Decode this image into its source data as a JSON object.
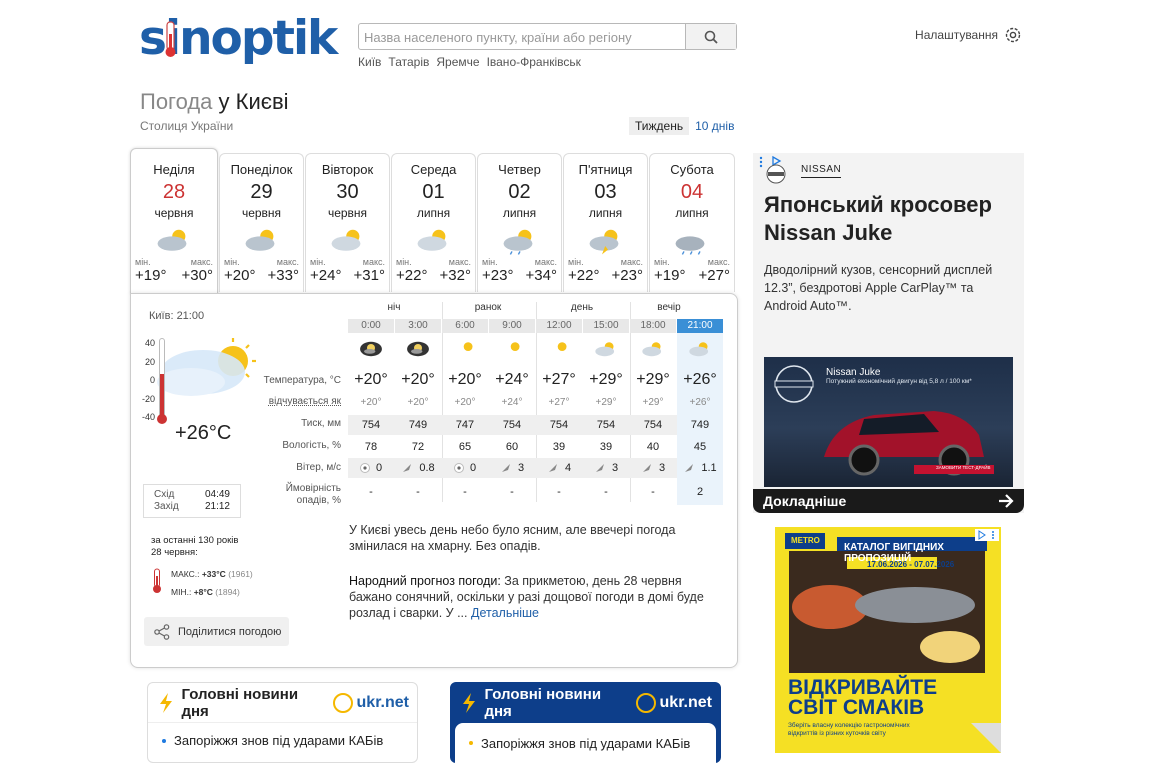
{
  "header": {
    "logo": "sinoptik",
    "search_placeholder": "Назва населеного пункту, країни або регіону",
    "quick_links": [
      "Київ",
      "Татарів",
      "Яремче",
      "Івано-Франківськ"
    ],
    "settings_label": "Налаштування"
  },
  "page": {
    "title_prefix": "Погода",
    "title_city": "у Києві",
    "subtitle": "Столиця України",
    "period_week": "Тиждень",
    "period_10days": "10 днів"
  },
  "days": [
    {
      "name": "Неділя",
      "date": "28",
      "month": "червня",
      "min": "+19°",
      "max": "+30°",
      "red": true,
      "icon": "partly-cloudy-icon"
    },
    {
      "name": "Понеділок",
      "date": "29",
      "month": "червня",
      "min": "+20°",
      "max": "+33°",
      "red": false,
      "icon": "partly-cloudy-icon"
    },
    {
      "name": "Вівторок",
      "date": "30",
      "month": "червня",
      "min": "+24°",
      "max": "+31°",
      "red": false,
      "icon": "sun-cloud-icon"
    },
    {
      "name": "Середа",
      "date": "01",
      "month": "липня",
      "min": "+22°",
      "max": "+32°",
      "red": false,
      "icon": "sun-cloud-icon"
    },
    {
      "name": "Четвер",
      "date": "02",
      "month": "липня",
      "min": "+23°",
      "max": "+34°",
      "red": false,
      "icon": "sun-cloud-rain-icon"
    },
    {
      "name": "П'ятниця",
      "date": "03",
      "month": "липня",
      "min": "+22°",
      "max": "+23°",
      "red": false,
      "icon": "thunder-icon"
    },
    {
      "name": "Субота",
      "date": "04",
      "month": "липня",
      "min": "+19°",
      "max": "+27°",
      "red": true,
      "icon": "rain-icon"
    }
  ],
  "labels": {
    "min": "мін.",
    "max": "макс."
  },
  "current": {
    "time": "Київ: 21:00",
    "scale": [
      "40",
      "20",
      "0",
      "-20",
      "-40"
    ],
    "temp": "+26°C",
    "sunrise_label": "Схід",
    "sunrise": "04:49",
    "sunset_label": "Захід",
    "sunset": "21:12",
    "history_title": "за останні 130 років",
    "history_date": "28 червня:",
    "hist_max_label": "МАКС.:",
    "hist_max": "+33°C",
    "hist_max_year": "(1961)",
    "hist_min_label": "МІН.:",
    "hist_min": "+8°C",
    "hist_min_year": "(1894)",
    "share": "Поділитися погодою"
  },
  "table": {
    "periods": [
      "ніч",
      "ранок",
      "день",
      "вечір"
    ],
    "hours": [
      "0:00",
      "3:00",
      "6:00",
      "9:00",
      "12:00",
      "15:00",
      "18:00",
      "21:00"
    ],
    "row_labels": {
      "temp": "Температура, °С",
      "feels": "відчувається як",
      "pressure": "Тиск, мм",
      "humidity": "Вологість, %",
      "wind": "Вітер, м/с",
      "precip_1": "Ймовірність",
      "precip_2": "опадів, %"
    },
    "icons": [
      "moon-cloud-icon",
      "moon-cloud-icon",
      "sun-icon",
      "sun-icon",
      "sun-icon",
      "sun-cloud-icon",
      "sun-cloud-icon",
      "sun-cloud-icon"
    ],
    "temp": [
      "+20°",
      "+20°",
      "+20°",
      "+24°",
      "+27°",
      "+29°",
      "+29°",
      "+26°"
    ],
    "feels": [
      "+20°",
      "+20°",
      "+20°",
      "+24°",
      "+27°",
      "+29°",
      "+29°",
      "+26°"
    ],
    "pressure": [
      "754",
      "749",
      "747",
      "754",
      "754",
      "754",
      "754",
      "749"
    ],
    "humidity": [
      "78",
      "72",
      "65",
      "60",
      "39",
      "39",
      "40",
      "45"
    ],
    "wind": [
      "0",
      "0.8",
      "0",
      "3",
      "4",
      "3",
      "3",
      "1.1"
    ],
    "wind_icons": [
      "calm-icon",
      "arrow-icon",
      "calm-icon",
      "arrow-icon",
      "arrow-icon",
      "arrow-icon",
      "arrow-icon",
      "arrow-icon"
    ],
    "precip": [
      "-",
      "-",
      "-",
      "-",
      "-",
      "-",
      "-",
      "2"
    ]
  },
  "description": "У Києві увесь день небо було ясним, але ввечері погода змінилася на хмарну. Без опадів.",
  "folk": {
    "label": "Народний прогноз погоди:",
    "text": " За прикметою, день 28 червня бажано сонячний, оскільки у разі дощової погоди в домі буде розлад і сварки. У ...",
    "link": "Детальніше"
  },
  "ad1": {
    "brand": "NISSAN",
    "headline": "Японський кросовер Nissan Juke",
    "text": "Дводолірний кузов, сенсорний дисплей 12.3”, бездротові Apple CarPlay™ та Android Auto™.",
    "img_title": "Nissan Juke",
    "img_sub": "Потужний економічний двигун від 5,8 л / 100 км*",
    "img_btn": "ЗАМОВИТИ ТЕСТ-ДРАЙВ",
    "cta": "Докладніше"
  },
  "ad2": {
    "logo": "METRO",
    "title": "КАТАЛОГ ВИГІДНИХ ПРОПОЗИЦІЙ",
    "dates": "17.06.2026 - 07.07.2026",
    "big1": "ВІДКРИВАЙТЕ",
    "big2": "СВІТ СМАКІВ",
    "small": "Зберіть власну колекцію гастрономічних відкриттів із різних куточків світу"
  },
  "news": [
    {
      "title": "Головні новини дня",
      "source": "ukr.net",
      "item": "Запоріжжя знов під ударами КАБів"
    },
    {
      "title": "Головні новини дня",
      "source": "ukr.net",
      "item": "Запоріжжя знов під ударами КАБів"
    }
  ],
  "colors": {
    "brand": "#1f5fa8",
    "red": "#c33",
    "news_blue": "#0d3e8a",
    "ad_yellow": "#f5e024"
  }
}
